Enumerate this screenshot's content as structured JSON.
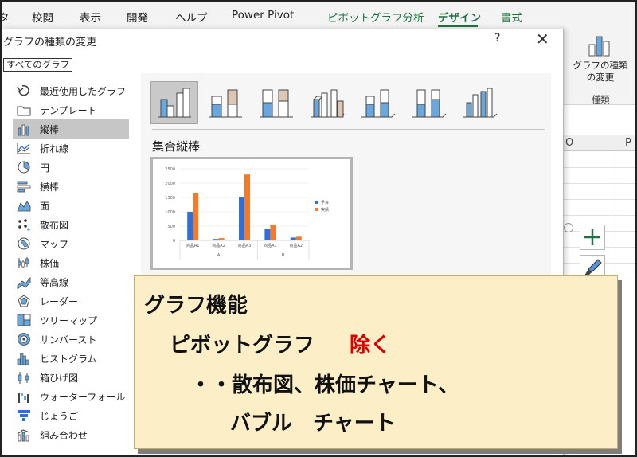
{
  "ribbon": {
    "tabs": [
      {
        "label": "タ"
      },
      {
        "label": "校閲"
      },
      {
        "label": "表示"
      },
      {
        "label": "開発"
      },
      {
        "label": "ヘルプ"
      },
      {
        "label": "Power Pivot"
      },
      {
        "label": "ピボットグラフ分析"
      },
      {
        "label": "デザイン"
      },
      {
        "label": "書式"
      }
    ],
    "active_tab": "デザイン",
    "change_chart_type_line1": "グラフの種類",
    "change_chart_type_line2": "の変更",
    "group_label": "種類"
  },
  "sheet": {
    "columns": [
      "O",
      "P"
    ]
  },
  "dialog": {
    "title": "グラフの種類の変更",
    "help_label": "?",
    "close_label": "✕",
    "tab_label": "すべてのグラフ",
    "chart_types": [
      {
        "label": "最近使用したグラフ",
        "icon": "recent-icon"
      },
      {
        "label": "テンプレート",
        "icon": "folder-icon"
      },
      {
        "label": "縦棒",
        "icon": "column-chart-icon",
        "selected": true
      },
      {
        "label": "折れ線",
        "icon": "line-chart-icon"
      },
      {
        "label": "円",
        "icon": "pie-chart-icon"
      },
      {
        "label": "横棒",
        "icon": "bar-chart-icon"
      },
      {
        "label": "面",
        "icon": "area-chart-icon"
      },
      {
        "label": "散布図",
        "icon": "scatter-chart-icon"
      },
      {
        "label": "マップ",
        "icon": "map-chart-icon"
      },
      {
        "label": "株価",
        "icon": "stock-chart-icon"
      },
      {
        "label": "等高線",
        "icon": "surface-chart-icon"
      },
      {
        "label": "レーダー",
        "icon": "radar-chart-icon"
      },
      {
        "label": "ツリーマップ",
        "icon": "treemap-chart-icon"
      },
      {
        "label": "サンバースト",
        "icon": "sunburst-chart-icon"
      },
      {
        "label": "ヒストグラム",
        "icon": "histogram-chart-icon"
      },
      {
        "label": "箱ひげ図",
        "icon": "boxplot-chart-icon"
      },
      {
        "label": "ウォーターフォール",
        "icon": "waterfall-chart-icon"
      },
      {
        "label": "じょうご",
        "icon": "funnel-chart-icon"
      },
      {
        "label": "組み合わせ",
        "icon": "combo-chart-icon"
      }
    ],
    "subtypes": [
      {
        "icon": "clustered-column-icon",
        "selected": true
      },
      {
        "icon": "stacked-column-icon"
      },
      {
        "icon": "100-stacked-column-icon"
      },
      {
        "icon": "3d-clustered-column-icon"
      },
      {
        "icon": "3d-stacked-column-icon"
      },
      {
        "icon": "3d-100-stacked-column-icon"
      },
      {
        "icon": "3d-column-icon"
      }
    ],
    "selected_subtype_name": "集合縦棒"
  },
  "chart_data": {
    "type": "bar",
    "categories": [
      "商品A1",
      "商品A2",
      "商品A3",
      "商品A1",
      "商品A2"
    ],
    "groups": [
      "A",
      "B"
    ],
    "series": [
      {
        "name": "予算",
        "values": [
          1000,
          50,
          1500,
          400,
          100
        ],
        "color": "#2f6fdc"
      },
      {
        "name": "実績",
        "values": [
          1650,
          80,
          2300,
          550,
          130
        ],
        "color": "#f47a2a"
      }
    ],
    "ylim": [
      0,
      2500
    ],
    "yticks": [
      "0",
      "500",
      "1000",
      "1500",
      "2000",
      "2500"
    ],
    "legend_position": "right"
  },
  "callout": {
    "line1": "グラフ機能",
    "line2_a": "ピボットグラフ",
    "line2_b": "除く",
    "line3": "・・散布図、株価チャート、",
    "line4": "バブル　チャート",
    "highlight_color": "#e00000"
  }
}
